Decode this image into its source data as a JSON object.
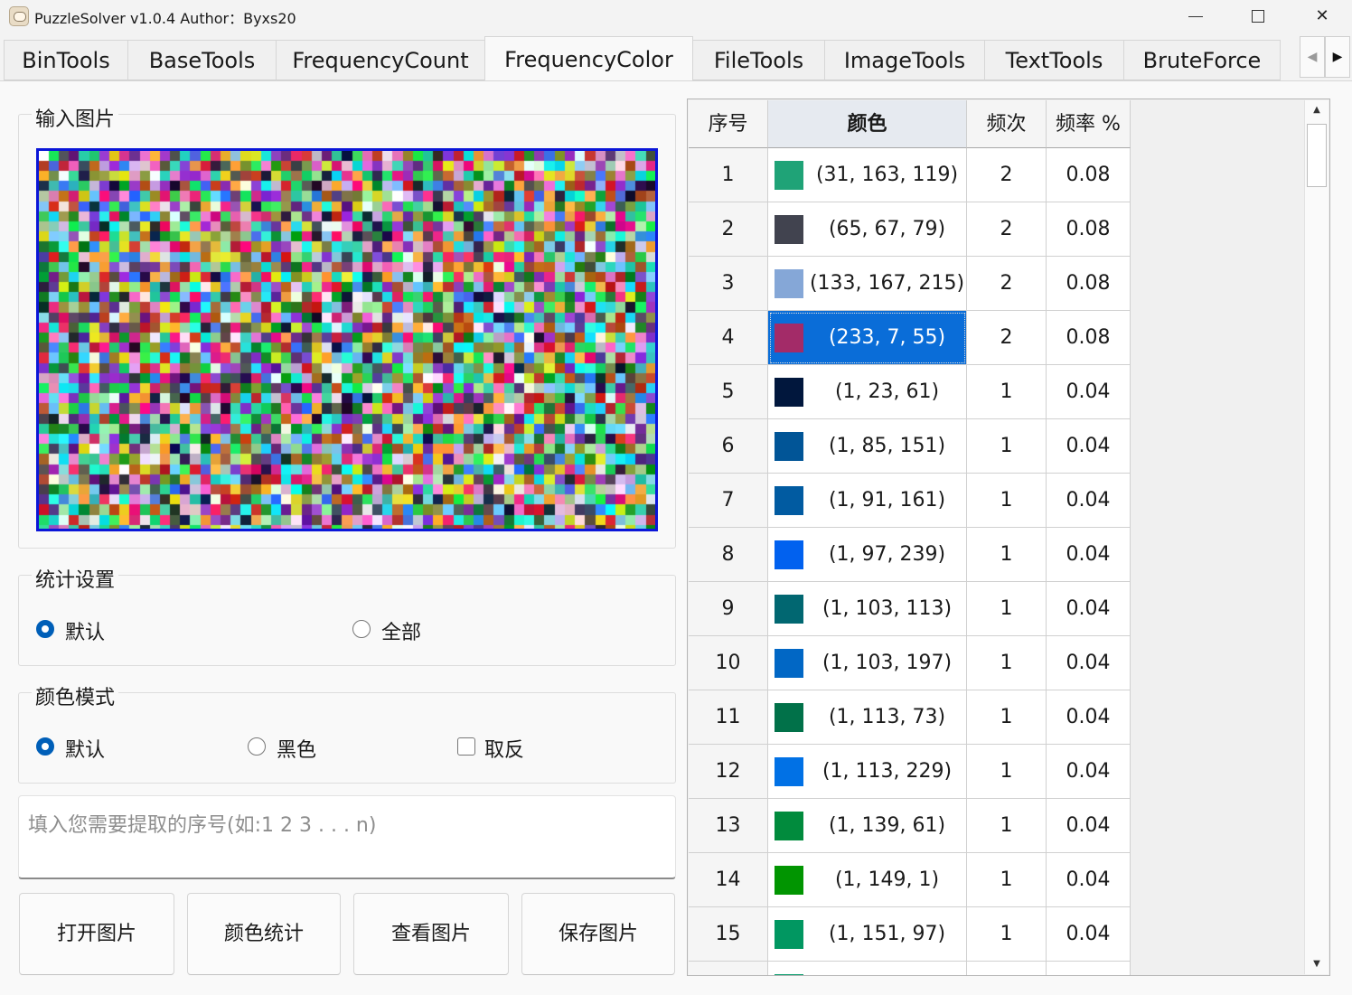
{
  "window": {
    "title": "PuzzleSolver v1.0.4  Author：Byxs20",
    "minimize": "",
    "maximize": "",
    "close": "✕"
  },
  "tabs": [
    {
      "label": "BinTools",
      "active": false
    },
    {
      "label": "BaseTools",
      "active": false
    },
    {
      "label": "FrequencyCount",
      "active": false
    },
    {
      "label": "FrequencyColor",
      "active": true
    },
    {
      "label": "FileTools",
      "active": false
    },
    {
      "label": "ImageTools",
      "active": false
    },
    {
      "label": "TextTools",
      "active": false
    },
    {
      "label": "BruteForce",
      "active": false
    }
  ],
  "tab_scroll": {
    "left": "◀",
    "right": "▶"
  },
  "input_image": {
    "title": "输入图片",
    "border_color": "#0b16d8"
  },
  "stat_settings": {
    "title": "统计设置",
    "options": [
      {
        "label": "默认",
        "checked": true
      },
      {
        "label": "全部",
        "checked": false
      }
    ]
  },
  "color_mode": {
    "title": "颜色模式",
    "options": [
      {
        "label": "默认",
        "checked": true
      },
      {
        "label": "黑色",
        "checked": false
      }
    ],
    "invert": {
      "label": "取反",
      "checked": false
    }
  },
  "index_input": {
    "placeholder": "填入您需要提取的序号(如:1 2 3 . . . n)",
    "value": ""
  },
  "buttons": {
    "open": "打开图片",
    "stats": "颜色统计",
    "view": "查看图片",
    "save": "保存图片"
  },
  "table": {
    "headers": [
      "序号",
      "颜色",
      "频次",
      "频率 %"
    ],
    "selected_row": 4,
    "rows": [
      {
        "index": "1",
        "rgb": "(31, 163, 119)",
        "hex": "#1fa377",
        "count": "2",
        "rate": "0.08"
      },
      {
        "index": "2",
        "rgb": "(65, 67, 79)",
        "hex": "#41434f",
        "count": "2",
        "rate": "0.08"
      },
      {
        "index": "3",
        "rgb": "(133, 167, 215)",
        "hex": "#85a7d7",
        "count": "2",
        "rate": "0.08"
      },
      {
        "index": "4",
        "rgb": "(233, 7, 55)",
        "hex": "#a32b68",
        "count": "2",
        "rate": "0.08"
      },
      {
        "index": "5",
        "rgb": "(1, 23, 61)",
        "hex": "#01173d",
        "count": "1",
        "rate": "0.04"
      },
      {
        "index": "6",
        "rgb": "(1, 85, 151)",
        "hex": "#015597",
        "count": "1",
        "rate": "0.04"
      },
      {
        "index": "7",
        "rgb": "(1, 91, 161)",
        "hex": "#015ba1",
        "count": "1",
        "rate": "0.04"
      },
      {
        "index": "8",
        "rgb": "(1, 97, 239)",
        "hex": "#0161ef",
        "count": "1",
        "rate": "0.04"
      },
      {
        "index": "9",
        "rgb": "(1, 103, 113)",
        "hex": "#016771",
        "count": "1",
        "rate": "0.04"
      },
      {
        "index": "10",
        "rgb": "(1, 103, 197)",
        "hex": "#0167c5",
        "count": "1",
        "rate": "0.04"
      },
      {
        "index": "11",
        "rgb": "(1, 113, 73)",
        "hex": "#017149",
        "count": "1",
        "rate": "0.04"
      },
      {
        "index": "12",
        "rgb": "(1, 113, 229)",
        "hex": "#0171e5",
        "count": "1",
        "rate": "0.04"
      },
      {
        "index": "13",
        "rgb": "(1, 139, 61)",
        "hex": "#018b3d",
        "count": "1",
        "rate": "0.04"
      },
      {
        "index": "14",
        "rgb": "(1, 149, 1)",
        "hex": "#019501",
        "count": "1",
        "rate": "0.04"
      },
      {
        "index": "15",
        "rgb": "(1, 151, 97)",
        "hex": "#019761",
        "count": "1",
        "rate": "0.04"
      }
    ]
  },
  "scrollbar": {
    "up": "▲",
    "down": "▼"
  }
}
